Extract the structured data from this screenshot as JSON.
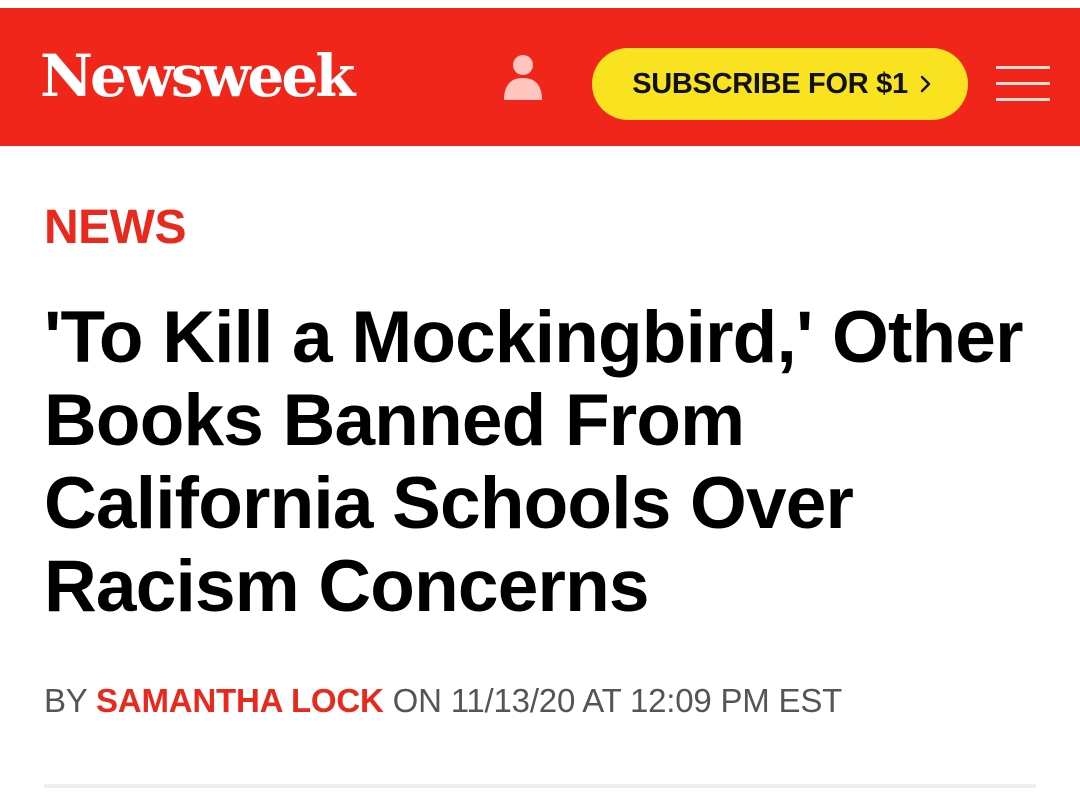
{
  "header": {
    "logo_text": "Newsweek",
    "account_icon": "person-icon",
    "subscribe_label": "SUBSCRIBE FOR $1",
    "subscribe_icon": "chevron-right-icon",
    "menu_icon": "hamburger-menu-icon"
  },
  "article": {
    "section": "NEWS",
    "headline": "'To Kill a Mockingbird,' Other Books Banned From California Schools Over Racism Concerns",
    "byline": {
      "prefix": "BY",
      "author": "SAMANTHA LOCK",
      "date_text": "ON 11/13/20 AT 12:09 PM EST"
    }
  },
  "colors": {
    "brand_red": "#f1261a",
    "subscribe_yellow": "#f9e321",
    "accent_red": "#e8291c",
    "byline_gray": "#555555"
  }
}
